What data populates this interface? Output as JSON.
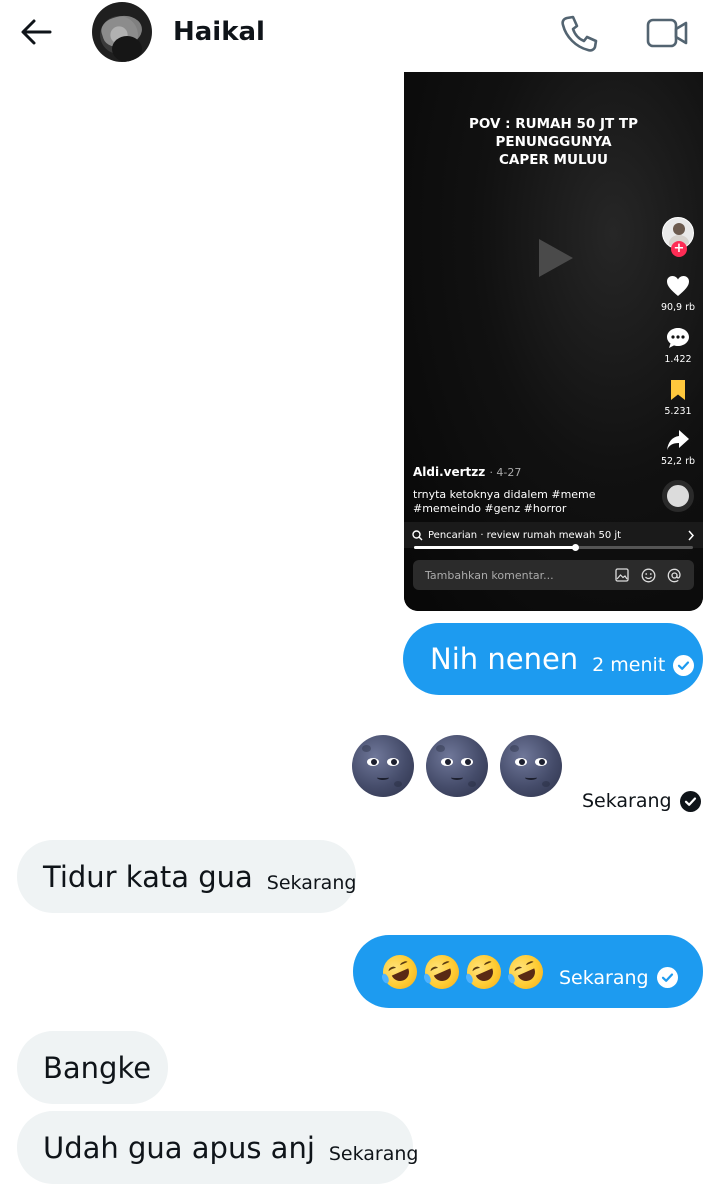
{
  "header": {
    "contact_name": "Haikal",
    "icons": {
      "back": "arrow-left-icon",
      "call": "phone-icon",
      "video": "video-camera-icon"
    }
  },
  "shared_video": {
    "overlay_title_line1": "POV : RUMAH 50 JT TP PENUNGGUNYA",
    "overlay_title_line2": "CAPER MULUU",
    "likes": "90,9 rb",
    "comments": "1.422",
    "saves": "5.231",
    "shares": "52,2 rb",
    "author": "Aldi.vertzz",
    "date": "· 4-27",
    "caption_line1": "trnyta ketoknya didalem #meme",
    "caption_line2": "#memeindo #genz #horror",
    "search_text": "Pencarian · review rumah mewah 50 jt",
    "progress": 0.58,
    "comment_placeholder": "Tambahkan komentar...",
    "colors": {
      "follow": "#fe2c55",
      "bookmark": "#ffc83d"
    }
  },
  "messages": [
    {
      "direction": "out",
      "text": "Nih nenen",
      "time": "2 menit",
      "status": "read"
    },
    {
      "direction": "out",
      "emoji": "new-moon-face x3",
      "time": "Sekarang",
      "status": "sent"
    },
    {
      "direction": "in",
      "text": "Tidur kata gua",
      "time": "Sekarang"
    },
    {
      "direction": "out",
      "emoji": "rolling-on-floor-laughing x4",
      "time": "Sekarang",
      "status": "read"
    },
    {
      "direction": "in",
      "text": "Bangke"
    },
    {
      "direction": "in",
      "text": "Udah gua apus anj",
      "time": "Sekarang"
    }
  ],
  "colors": {
    "outgoing_bubble": "#1d9bf0",
    "incoming_bubble": "#eff3f4",
    "text": "#0f1419"
  }
}
